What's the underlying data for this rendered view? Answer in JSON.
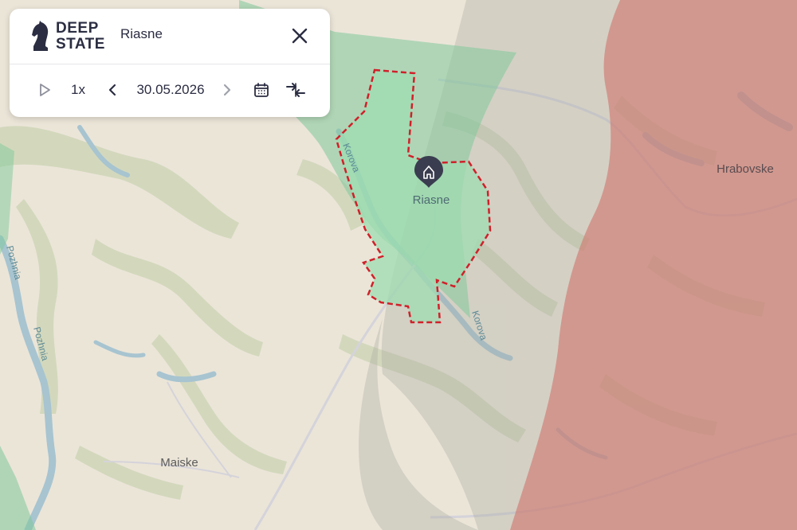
{
  "app": {
    "brand_line1": "DEEP",
    "brand_line2": "STATE",
    "place_title": "Riasne"
  },
  "controls": {
    "play_icon": "play-icon",
    "speed": "1x",
    "prev_icon": "chevron-left-icon",
    "date": "30.05.2026",
    "next_icon": "chevron-right-icon",
    "calendar_icon": "calendar-icon",
    "compare_icon": "compare-arrows-icon",
    "close_icon": "close-icon"
  },
  "map": {
    "labels": {
      "riasne": "Riasne",
      "hrabovske": "Hrabovske",
      "maiske": "Maiske",
      "pozhnia_top": "Pozhnia",
      "pozhnia_mid": "Pozhnia",
      "korova_north": "Korova",
      "korova_south": "Korova"
    },
    "marker_icon": "home-pin-icon",
    "colors": {
      "land": "#ebe5d8",
      "occupied": "#c9837a",
      "liberated": "#7fc99a",
      "contested": "#a9b7a3",
      "water": "#a7c4d0",
      "border_dashed": "#d0202a"
    }
  }
}
